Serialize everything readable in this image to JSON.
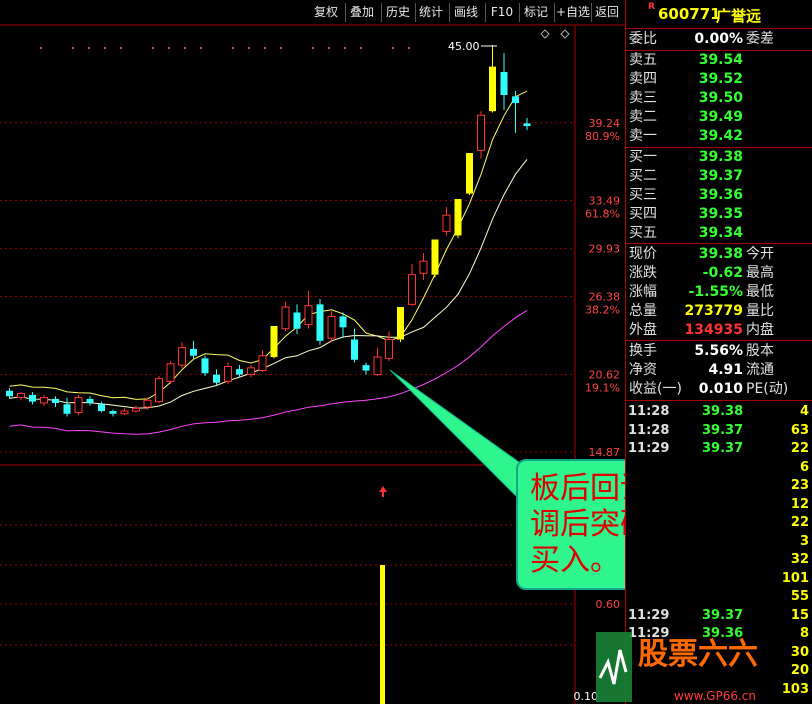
{
  "toolbar": {
    "buttons": [
      "复权",
      "叠加",
      "历史",
      "统计",
      "画线",
      "F10",
      "标记",
      "+自选",
      "返回"
    ]
  },
  "header": {
    "code": "600771",
    "name": "广誉远",
    "r_mark": "R"
  },
  "colors": {
    "up": "#ff3333",
    "down": "#33ffff",
    "limit_up": "#ffff00",
    "ma_short": "#ffff66",
    "ma_mid": "#ffffcc",
    "ma_long": "#ff44ff",
    "grid": "#8b0000",
    "callout_bg": "#2ff58f",
    "callout_text": "#e00000"
  },
  "order_book": {
    "weibi_label": "委比",
    "weibi_value": "0.00%",
    "weicha_label": "委差",
    "asks": [
      {
        "label": "卖五",
        "price": "39.54"
      },
      {
        "label": "卖四",
        "price": "39.52"
      },
      {
        "label": "卖三",
        "price": "39.50"
      },
      {
        "label": "卖二",
        "price": "39.49"
      },
      {
        "label": "卖一",
        "price": "39.42"
      }
    ],
    "bids": [
      {
        "label": "买一",
        "price": "39.38"
      },
      {
        "label": "买二",
        "price": "39.37"
      },
      {
        "label": "买三",
        "price": "39.36"
      },
      {
        "label": "买四",
        "price": "39.35"
      },
      {
        "label": "买五",
        "price": "39.34"
      }
    ]
  },
  "quote": {
    "rows": [
      {
        "label": "现价",
        "value": "39.38",
        "label2": "今开",
        "color": "#3f3"
      },
      {
        "label": "涨跌",
        "value": "-0.62",
        "label2": "最高",
        "color": "#3f3"
      },
      {
        "label": "涨幅",
        "value": "-1.55%",
        "label2": "最低",
        "color": "#3f3"
      },
      {
        "label": "总量",
        "value": "273779",
        "label2": "量比",
        "color": "#ff0"
      },
      {
        "label": "外盘",
        "value": "134935",
        "label2": "内盘",
        "color": "#f33"
      }
    ],
    "rows2": [
      {
        "label": "换手",
        "value": "5.56%",
        "label2": "股本"
      },
      {
        "label": "净资",
        "value": "4.91",
        "label2": "流通"
      },
      {
        "label": "收益(一)",
        "value": "0.010",
        "label2": "PE(动)"
      }
    ]
  },
  "ticks": [
    {
      "time": "11:28",
      "price": "39.38",
      "vol": "4"
    },
    {
      "time": "11:28",
      "price": "39.37",
      "vol": "63"
    },
    {
      "time": "11:29",
      "price": "39.37",
      "vol": "22"
    },
    {
      "time": "",
      "price": "",
      "vol": "6"
    },
    {
      "time": "",
      "price": "",
      "vol": "23"
    },
    {
      "time": "",
      "price": "",
      "vol": "12"
    },
    {
      "time": "",
      "price": "",
      "vol": "22"
    },
    {
      "time": "",
      "price": "",
      "vol": "3"
    },
    {
      "time": "",
      "price": "",
      "vol": "32"
    },
    {
      "time": "",
      "price": "",
      "vol": "101"
    },
    {
      "time": "",
      "price": "",
      "vol": "55"
    },
    {
      "time": "11:29",
      "price": "39.37",
      "vol": "15"
    },
    {
      "time": "11:29",
      "price": "39.36",
      "vol": "8"
    },
    {
      "time": "",
      "price": "",
      "vol": "30"
    },
    {
      "time": "",
      "price": "",
      "vol": "20"
    },
    {
      "time": "",
      "price": "",
      "vol": "103"
    }
  ],
  "callout": {
    "lines": [
      "板后回调，回",
      "调后突破中轨",
      "买入。"
    ]
  },
  "logo": {
    "text": "股票六六",
    "sub": "www.GP66.cn"
  },
  "chart_data": {
    "type": "candlestick",
    "ylim": [
      14.87,
      45.0
    ],
    "price_labels": [
      {
        "price": "39.24",
        "pct": "80.9%"
      },
      {
        "price": "33.49",
        "pct": "61.8%"
      },
      {
        "price": "29.93",
        "pct": ""
      },
      {
        "price": "26.38",
        "pct": "38.2%"
      },
      {
        "price": "20.62",
        "pct": "19.1%"
      },
      {
        "price": "14.87",
        "pct": ""
      }
    ],
    "high_marker": "45.00",
    "candles": [
      {
        "o": 19.4,
        "c": 19.0,
        "h": 19.6,
        "l": 18.8,
        "limit": false
      },
      {
        "o": 18.9,
        "c": 19.2,
        "h": 19.3,
        "l": 18.7,
        "limit": false
      },
      {
        "o": 19.1,
        "c": 18.6,
        "h": 19.3,
        "l": 18.4,
        "limit": false
      },
      {
        "o": 18.5,
        "c": 18.9,
        "h": 19.1,
        "l": 18.3,
        "limit": false
      },
      {
        "o": 18.8,
        "c": 18.5,
        "h": 19.0,
        "l": 18.2,
        "limit": false
      },
      {
        "o": 18.4,
        "c": 17.7,
        "h": 18.9,
        "l": 17.5,
        "limit": false
      },
      {
        "o": 17.8,
        "c": 18.9,
        "h": 19.1,
        "l": 17.6,
        "limit": false
      },
      {
        "o": 18.8,
        "c": 18.5,
        "h": 19.0,
        "l": 18.3,
        "limit": false
      },
      {
        "o": 18.4,
        "c": 17.9,
        "h": 18.6,
        "l": 17.8,
        "limit": false
      },
      {
        "o": 17.9,
        "c": 17.7,
        "h": 18.0,
        "l": 17.5,
        "limit": false
      },
      {
        "o": 17.7,
        "c": 17.9,
        "h": 18.1,
        "l": 17.6,
        "limit": false
      },
      {
        "o": 17.9,
        "c": 18.1,
        "h": 18.3,
        "l": 17.8,
        "limit": false
      },
      {
        "o": 18.2,
        "c": 18.7,
        "h": 18.9,
        "l": 18.0,
        "limit": false
      },
      {
        "o": 18.6,
        "c": 20.3,
        "h": 20.5,
        "l": 18.5,
        "limit": false
      },
      {
        "o": 20.1,
        "c": 21.4,
        "h": 21.6,
        "l": 19.9,
        "limit": false
      },
      {
        "o": 21.3,
        "c": 22.6,
        "h": 23.0,
        "l": 21.1,
        "limit": false
      },
      {
        "o": 22.5,
        "c": 22.0,
        "h": 23.1,
        "l": 21.8,
        "limit": false
      },
      {
        "o": 21.8,
        "c": 20.7,
        "h": 22.0,
        "l": 20.5,
        "limit": false
      },
      {
        "o": 20.6,
        "c": 20.0,
        "h": 21.0,
        "l": 19.8,
        "limit": false
      },
      {
        "o": 20.1,
        "c": 21.2,
        "h": 21.5,
        "l": 19.9,
        "limit": false
      },
      {
        "o": 21.0,
        "c": 20.6,
        "h": 21.3,
        "l": 20.4,
        "limit": false
      },
      {
        "o": 20.6,
        "c": 21.1,
        "h": 21.3,
        "l": 20.4,
        "limit": false
      },
      {
        "o": 20.9,
        "c": 22.0,
        "h": 22.4,
        "l": 20.8,
        "limit": false
      },
      {
        "o": 21.9,
        "c": 24.2,
        "h": 24.2,
        "l": 21.8,
        "limit": true
      },
      {
        "o": 24.0,
        "c": 25.6,
        "h": 26.0,
        "l": 23.8,
        "limit": false
      },
      {
        "o": 25.2,
        "c": 24.0,
        "h": 25.8,
        "l": 23.6,
        "limit": false
      },
      {
        "o": 24.3,
        "c": 25.7,
        "h": 26.8,
        "l": 24.0,
        "limit": false
      },
      {
        "o": 25.8,
        "c": 23.1,
        "h": 26.2,
        "l": 22.8,
        "limit": false
      },
      {
        "o": 23.3,
        "c": 24.9,
        "h": 25.3,
        "l": 23.0,
        "limit": false
      },
      {
        "o": 24.9,
        "c": 24.1,
        "h": 25.2,
        "l": 23.3,
        "limit": false
      },
      {
        "o": 23.2,
        "c": 21.7,
        "h": 24.0,
        "l": 21.5,
        "limit": false
      },
      {
        "o": 21.3,
        "c": 20.9,
        "h": 21.5,
        "l": 20.6,
        "limit": false
      },
      {
        "o": 20.6,
        "c": 21.9,
        "h": 22.6,
        "l": 20.5,
        "limit": false
      },
      {
        "o": 21.8,
        "c": 23.2,
        "h": 23.8,
        "l": 21.6,
        "limit": false
      },
      {
        "o": 23.2,
        "c": 25.6,
        "h": 25.6,
        "l": 23.0,
        "limit": true
      },
      {
        "o": 25.8,
        "c": 28.0,
        "h": 28.8,
        "l": 25.7,
        "limit": false
      },
      {
        "o": 28.1,
        "c": 29.0,
        "h": 29.6,
        "l": 27.6,
        "limit": false
      },
      {
        "o": 28.0,
        "c": 30.6,
        "h": 30.6,
        "l": 27.8,
        "limit": true
      },
      {
        "o": 31.2,
        "c": 32.4,
        "h": 33.0,
        "l": 30.9,
        "limit": false
      },
      {
        "o": 30.9,
        "c": 33.6,
        "h": 33.6,
        "l": 30.7,
        "limit": true
      },
      {
        "o": 34.0,
        "c": 37.0,
        "h": 37.0,
        "l": 33.9,
        "limit": true
      },
      {
        "o": 37.2,
        "c": 39.8,
        "h": 40.1,
        "l": 36.6,
        "limit": false
      },
      {
        "o": 40.1,
        "c": 43.4,
        "h": 45.0,
        "l": 40.0,
        "limit": true
      },
      {
        "o": 43.0,
        "c": 41.3,
        "h": 44.4,
        "l": 40.2,
        "limit": false
      },
      {
        "o": 41.2,
        "c": 40.7,
        "h": 41.6,
        "l": 38.5,
        "limit": false
      },
      {
        "o": 39.2,
        "c": 39.0,
        "h": 39.6,
        "l": 38.7,
        "limit": false
      }
    ]
  }
}
